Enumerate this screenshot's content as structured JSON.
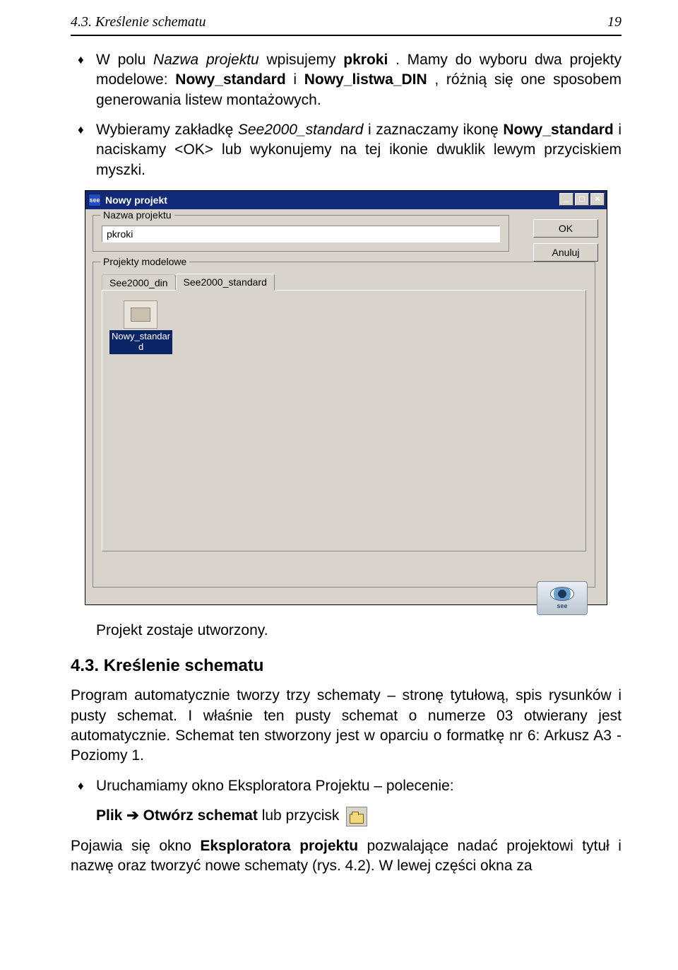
{
  "header": {
    "title": "4.3. Kreślenie schematu",
    "page_number": "19"
  },
  "bullets": {
    "b1_pre": "W polu ",
    "b1_field": "Nazwa projektu",
    "b1_mid": " wpisujemy ",
    "b1_val": "pkroki",
    "b1_post1": ". Mamy do wyboru dwa projekty modelowe: ",
    "b1_m1": "Nowy_standard",
    "b1_and": " i ",
    "b1_m2": "Nowy_listwa_DIN",
    "b1_end": ", różnią się one sposobem generowania listew montażowych.",
    "b2_pre": "Wybieramy zakładkę ",
    "b2_tab": "See2000_standard",
    "b2_mid": " i zaznaczamy ikonę ",
    "b2_icon": "No­wy_standard",
    "b2_end": " i naciskamy <OK> lub wykonujemy na tej ikonie dwu­klik lewym przyciskiem myszki."
  },
  "dialog": {
    "title": "Nowy projekt",
    "group_name": "Nazwa projektu",
    "name_value": "pkroki",
    "ok": "OK",
    "cancel": "Anuluj",
    "group_models": "Projekty modelowe",
    "tab1": "See2000_din",
    "tab2": "See2000_standard",
    "folder_label": "Nowy_standar\nd",
    "logo_text": "see"
  },
  "after_dialog": "Projekt zostaje utworzony.",
  "section_heading": "4.3. Kreślenie schematu",
  "para1": "Program automatycznie tworzy trzy schematy – stronę tytułową, spis rysun­ków i pusty schemat. I właśnie ten pusty schemat o numerze 03 otwierany jest automatycznie. Schemat ten stworzony jest w oparciu o formatkę nr 6: Arkusz A3 - Poziomy 1.",
  "bullet3": "Uruchamiamy okno Eksploratora Projektu – polecenie:",
  "menu": {
    "item1": "Plik",
    "arrow": " ➔ ",
    "item2": "Otwórz schemat",
    "after": " lub przycisk "
  },
  "para2_pre": "Pojawia się okno ",
  "para2_bold": "Eksploratora projektu",
  "para2_post": " pozwalające nadać projektowi ty­tuł i nazwę oraz tworzyć nowe schematy (rys. 4.2). W lewej części okna za­"
}
